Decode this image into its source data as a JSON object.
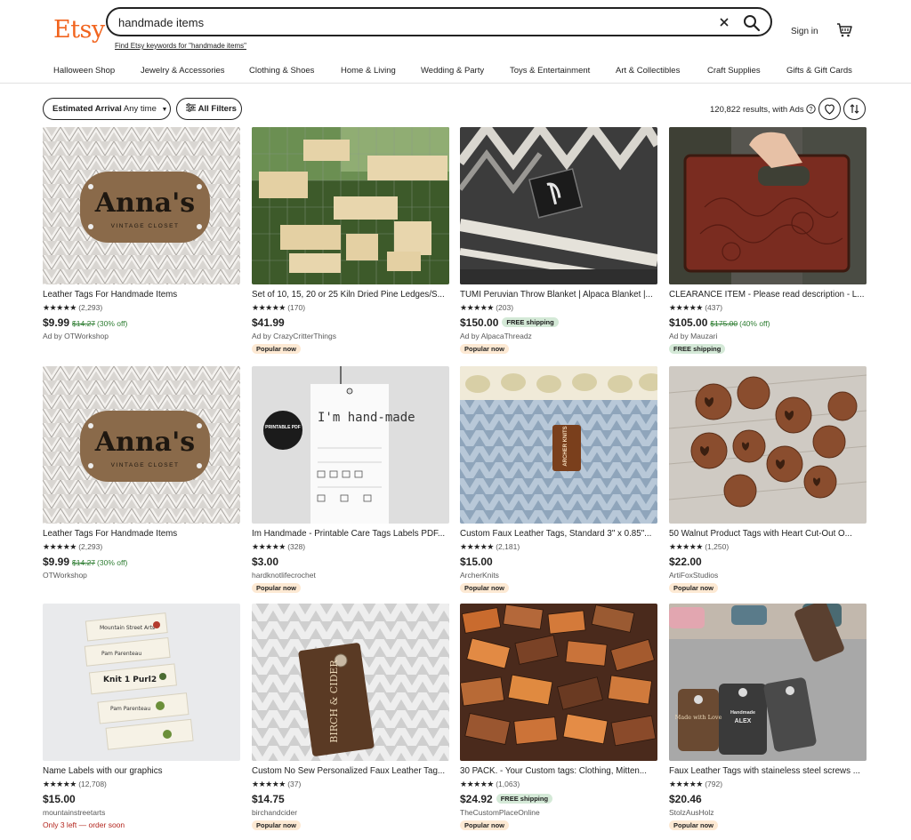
{
  "header": {
    "logo": "Etsy",
    "search_value": "handmade items",
    "keywords_link": "Find Etsy keywords for \"handmade items\"",
    "sign_in": "Sign in"
  },
  "categories": [
    "Halloween Shop",
    "Jewelry & Accessories",
    "Clothing & Shoes",
    "Home & Living",
    "Wedding & Party",
    "Toys & Entertainment",
    "Art & Collectibles",
    "Craft Supplies",
    "Gifts & Gift Cards"
  ],
  "filters": {
    "arrival_label": "Estimated Arrival",
    "arrival_value": "Any time",
    "all_filters": "All Filters",
    "results": "120,822 results, with Ads"
  },
  "listings": [
    {
      "title": "Leather Tags For Handmade Items",
      "stars": "★★★★★",
      "reviews": "(2,293)",
      "price": "$9.99",
      "orig": "$14.27",
      "off": "(30% off)",
      "free_shipping": "",
      "shop": "Ad by OTWorkshop",
      "badge": "",
      "low_stock": ""
    },
    {
      "title": "Set of 10, 15, 20 or 25 Kiln Dried Pine Ledges/S...",
      "stars": "★★★★★",
      "reviews": "(170)",
      "price": "$41.99",
      "orig": "",
      "off": "",
      "free_shipping": "",
      "shop": "Ad by CrazyCritterThings",
      "badge": "Popular now",
      "low_stock": ""
    },
    {
      "title": "TUMI Peruvian Throw Blanket | Alpaca Blanket |...",
      "stars": "★★★★★",
      "reviews": "(203)",
      "price": "$150.00",
      "orig": "",
      "off": "",
      "free_shipping": "FREE shipping",
      "shop": "Ad by AlpacaThreadz",
      "badge": "Popular now",
      "low_stock": ""
    },
    {
      "title": "CLEARANCE ITEM - Please read description - L...",
      "stars": "★★★★★",
      "reviews": "(437)",
      "price": "$105.00",
      "orig": "$175.00",
      "off": "(40% off)",
      "free_shipping": "",
      "shop": "Ad by Mauzari",
      "badge": "FREE shipping",
      "low_stock": ""
    },
    {
      "title": "Leather Tags For Handmade Items",
      "stars": "★★★★★",
      "reviews": "(2,293)",
      "price": "$9.99",
      "orig": "$14.27",
      "off": "(30% off)",
      "free_shipping": "",
      "shop": "OTWorkshop",
      "badge": "",
      "low_stock": ""
    },
    {
      "title": "Im Handmade - Printable Care Tags Labels PDF...",
      "stars": "★★★★★",
      "reviews": "(328)",
      "price": "$3.00",
      "orig": "",
      "off": "",
      "free_shipping": "",
      "shop": "hardknotlifecrochet",
      "badge": "Popular now",
      "low_stock": ""
    },
    {
      "title": "Custom Faux Leather Tags, Standard 3\" x 0.85\"...",
      "stars": "★★★★★",
      "reviews": "(2,181)",
      "price": "$15.00",
      "orig": "",
      "off": "",
      "free_shipping": "",
      "shop": "ArcherKnits",
      "badge": "Popular now",
      "low_stock": ""
    },
    {
      "title": "50 Walnut Product Tags with Heart Cut-Out O...",
      "stars": "★★★★★",
      "reviews": "(1,250)",
      "price": "$22.00",
      "orig": "",
      "off": "",
      "free_shipping": "",
      "shop": "ArtiFoxStudios",
      "badge": "Popular now",
      "low_stock": ""
    },
    {
      "title": "Name Labels with our graphics",
      "stars": "★★★★★",
      "reviews": "(12,708)",
      "price": "$15.00",
      "orig": "",
      "off": "",
      "free_shipping": "",
      "shop": "mountainstreetarts",
      "badge": "",
      "low_stock": "Only 3 left — order soon"
    },
    {
      "title": "Custom No Sew Personalized Faux Leather Tag...",
      "stars": "★★★★★",
      "reviews": "(37)",
      "price": "$14.75",
      "orig": "",
      "off": "",
      "free_shipping": "",
      "shop": "birchandcider",
      "badge": "Popular now",
      "low_stock": ""
    },
    {
      "title": "30 PACK. - Your Custom tags: Clothing, Mitten...",
      "stars": "★★★★★",
      "reviews": "(1,063)",
      "price": "$24.92",
      "orig": "",
      "off": "",
      "free_shipping": "FREE shipping",
      "shop": "TheCustomPlaceOnline",
      "badge": "Popular now",
      "low_stock": ""
    },
    {
      "title": "Faux Leather Tags with staineless steel screws ...",
      "stars": "★★★★★",
      "reviews": "(792)",
      "price": "$20.46",
      "orig": "",
      "off": "",
      "free_shipping": "",
      "shop": "StolzAusHolz",
      "badge": "Popular now",
      "low_stock": ""
    }
  ],
  "image_text": {
    "annas": "Anna's",
    "vintage": "VINTAGE CLOSET",
    "printable": "PRINTABLE PDF",
    "im_handmade": "I'm hand-made",
    "archer": "ARCHER KNITS",
    "birch": "BIRCH & CIDER",
    "knit": "Knit 1 Purl2",
    "mountain": "Mountain Street Arts",
    "pam": "Pam Parenteau",
    "made_with_love": "Made with Love",
    "handmade": "Handmade",
    "alex": "ALEX"
  },
  "colors": {
    "brand": "#f1641e",
    "sale": "#2e7d32",
    "popular_bg": "#fde9d3",
    "free_bg": "#d4e9d7"
  }
}
